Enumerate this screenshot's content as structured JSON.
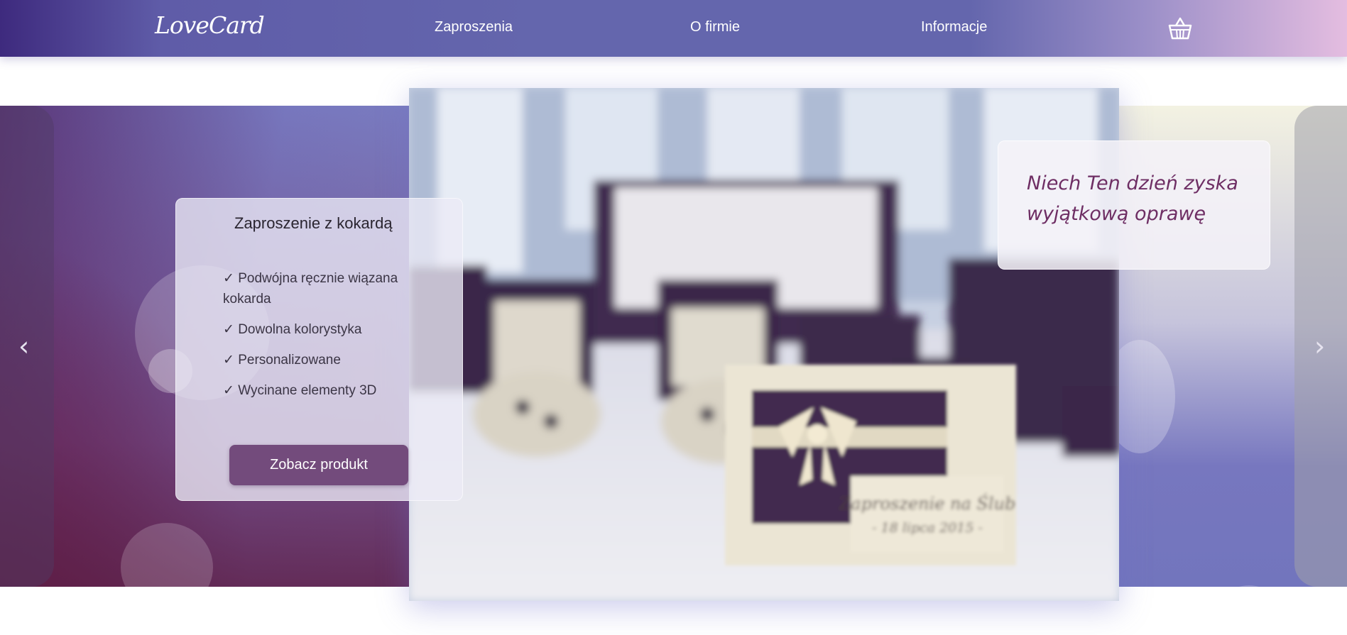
{
  "header": {
    "logo": "LoveCard",
    "nav": [
      "Zaproszenia",
      "O firmie",
      "Informacje"
    ],
    "cart_icon": "basket-icon"
  },
  "slider": {
    "prev_arrow": "‹",
    "next_arrow": "›",
    "card": {
      "title": "Zaproszenie z kokardą",
      "features": [
        "✓ Podwójna ręcznie wiązana kokarda",
        "✓ Dowolna kolorystyka",
        "✓ Personalizowane",
        "✓ Wycinane elementy 3D"
      ],
      "button_label": "Zobacz produkt"
    },
    "photo": {
      "card_text_line1": "Zaproszenie na Ślub",
      "card_text_line2": "- 18 lipca 2015 -"
    },
    "tagline": "Niech Ten dzień zyska wyjątkową oprawę"
  },
  "colors": {
    "accent": "#734b7c",
    "tagline": "#6e2e64",
    "nav_gradient_start": "#3e2a7e",
    "nav_gradient_end": "#e4bde0"
  }
}
